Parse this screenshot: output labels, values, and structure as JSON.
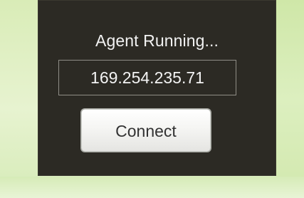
{
  "agent_panel": {
    "status_text": "Agent Running...",
    "ip_address": "169.254.235.71",
    "connect_button_label": "Connect"
  },
  "colors": {
    "panel_background": "#2c2a24",
    "background_green": "#e4f2c8",
    "text_light": "#f2f2f2",
    "button_text": "#333333"
  }
}
